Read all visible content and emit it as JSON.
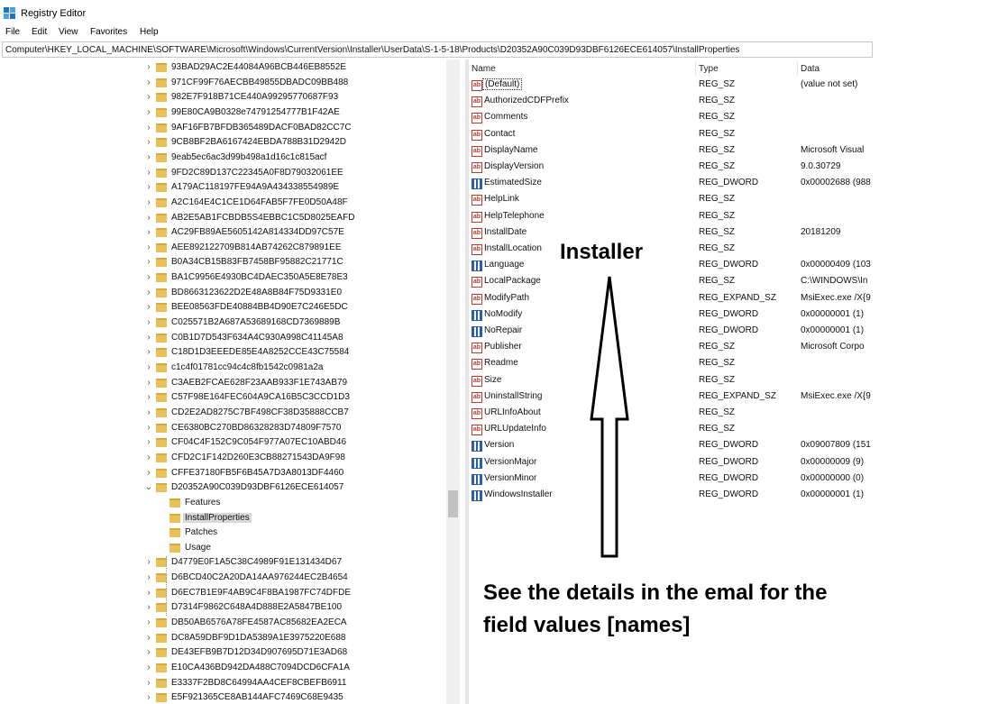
{
  "window": {
    "title": "Registry Editor",
    "menu": [
      "File",
      "Edit",
      "View",
      "Favorites",
      "Help"
    ],
    "address": "Computer\\HKEY_LOCAL_MACHINE\\SOFTWARE\\Microsoft\\Windows\\CurrentVersion\\Installer\\UserData\\S-1-5-18\\Products\\D20352A90C039D93DBF6126ECE614057\\InstallProperties"
  },
  "tree": {
    "keys_before": [
      "93BAD29AC2E44084A96BCB446EB8552E",
      "971CF99F76AECBB49855DBADC09BB488",
      "982E7F918B71CE440A99295770687F93",
      "99E80CA9B0328e74791254777B1F42AE",
      "9AF16FB7BFDB365489DACF0BAD82CC7C",
      "9CB8BF2BA6167424EBDA788B31D2942D",
      "9eab5ec6ac3d99b498a1d16c1c815acf",
      "9FD2C89D137C22345A0F8D79032061EE",
      "A179AC118197FE94A9A434338554989E",
      "A2C164E4C1CE1D64FAB5F7FE0D50A48F",
      "AB2E5AB1FCBDB5S4EBBC1C5D8025EAFD",
      "AC29FB89AE5605142A814334DD97C57E",
      "AEE892122709B814AB74262C879891EE",
      "B0A34CB15B83FB7458BF95882C21771C",
      "BA1C9956E4930BC4DAEC350A5E8E78E3",
      "BD8663123622D2E48A8B84F75D9331E0",
      "BEE08563FDE40884BB4D90E7C246E5DC",
      "C025571B2A687A53689168CD7369889B",
      "C0B1D7D543F634A4C930A998C41145A8",
      "C18D1D3EEEDE85E4A8252CCE43C75584",
      "c1c4f01781cc94c4c8fb1542c0981a2a",
      "C3AEB2FCAE628F23AAB933F1E743AB79",
      "C57F98E164FEC604A9CA16B5C3CCD1D3",
      "CD2E2AD8275C7BF498CF38D35888CCB7",
      "CE6380BC270BD86328283D74809F7570",
      "CF04C4F152C9C054F977A07EC10ABD46",
      "CFD2C1F142D260E3CB88271543DA9F98",
      "CFFE37180FB5F6B45A7D3A8013DF4460"
    ],
    "expanded_key": "D20352A90C039D93DBF6126ECE614057",
    "subkeys": [
      "Features",
      "InstallProperties",
      "Patches",
      "Usage"
    ],
    "selected_subkey_index": 1,
    "keys_after": [
      "D4779E0F1A5C38C4989F91E131434D67",
      "D6BCD40C2A20DA14AA976244EC2B4654",
      "D6EC7B1E9F4AB9C4F8BA1987FC74DFDE",
      "D7314F9862C648A4D888E2A5847BE100",
      "DB50AB6576A78FE4587AC85682EA2ECA",
      "DC8A59DBF9D1DA5389A1E3975220E688",
      "DE43EFB9B7D12D34D907695D71E3AD68",
      "E10CA436BD942DA488C7094DCD6CFA1A",
      "E3337F2BD8C64994AA4CEF8CBEFB6911",
      "E5F921365CE8AB144AFC7469C68E9435"
    ]
  },
  "values": {
    "headers": {
      "name": "Name",
      "type": "Type",
      "data": "Data"
    },
    "rows": [
      {
        "name": "(Default)",
        "type": "REG_SZ",
        "data": "(value not set)",
        "icon": "string-value-icon"
      },
      {
        "name": "AuthorizedCDFPrefix",
        "type": "REG_SZ",
        "data": "",
        "icon": "string-value-icon"
      },
      {
        "name": "Comments",
        "type": "REG_SZ",
        "data": "",
        "icon": "string-value-icon"
      },
      {
        "name": "Contact",
        "type": "REG_SZ",
        "data": "",
        "icon": "string-value-icon"
      },
      {
        "name": "DisplayName",
        "type": "REG_SZ",
        "data": "Microsoft Visual",
        "icon": "string-value-icon"
      },
      {
        "name": "DisplayVersion",
        "type": "REG_SZ",
        "data": "9.0.30729",
        "icon": "string-value-icon"
      },
      {
        "name": "EstimatedSize",
        "type": "REG_DWORD",
        "data": "0x00002688 (988",
        "icon": "binary-value-icon"
      },
      {
        "name": "HelpLink",
        "type": "REG_SZ",
        "data": "",
        "icon": "string-value-icon"
      },
      {
        "name": "HelpTelephone",
        "type": "REG_SZ",
        "data": "",
        "icon": "string-value-icon"
      },
      {
        "name": "InstallDate",
        "type": "REG_SZ",
        "data": "20181209",
        "icon": "string-value-icon"
      },
      {
        "name": "InstallLocation",
        "type": "REG_SZ",
        "data": "",
        "icon": "string-value-icon"
      },
      {
        "name": "Language",
        "type": "REG_DWORD",
        "data": "0x00000409 (103",
        "icon": "binary-value-icon"
      },
      {
        "name": "LocalPackage",
        "type": "REG_SZ",
        "data": "C:\\WINDOWS\\In",
        "icon": "string-value-icon"
      },
      {
        "name": "ModifyPath",
        "type": "REG_EXPAND_SZ",
        "data": "MsiExec.exe /X{9",
        "icon": "string-value-icon"
      },
      {
        "name": "NoModify",
        "type": "REG_DWORD",
        "data": "0x00000001 (1)",
        "icon": "binary-value-icon"
      },
      {
        "name": "NoRepair",
        "type": "REG_DWORD",
        "data": "0x00000001 (1)",
        "icon": "binary-value-icon"
      },
      {
        "name": "Publisher",
        "type": "REG_SZ",
        "data": "Microsoft Corpo",
        "icon": "string-value-icon"
      },
      {
        "name": "Readme",
        "type": "REG_SZ",
        "data": "",
        "icon": "string-value-icon"
      },
      {
        "name": "Size",
        "type": "REG_SZ",
        "data": "",
        "icon": "string-value-icon"
      },
      {
        "name": "UninstallString",
        "type": "REG_EXPAND_SZ",
        "data": "MsiExec.exe /X{9",
        "icon": "string-value-icon"
      },
      {
        "name": "URLInfoAbout",
        "type": "REG_SZ",
        "data": "",
        "icon": "string-value-icon"
      },
      {
        "name": "URLUpdateInfo",
        "type": "REG_SZ",
        "data": "",
        "icon": "string-value-icon"
      },
      {
        "name": "Version",
        "type": "REG_DWORD",
        "data": "0x09007809 (151",
        "icon": "binary-value-icon"
      },
      {
        "name": "VersionMajor",
        "type": "REG_DWORD",
        "data": "0x00000009 (9)",
        "icon": "binary-value-icon"
      },
      {
        "name": "VersionMinor",
        "type": "REG_DWORD",
        "data": "0x00000000 (0)",
        "icon": "binary-value-icon"
      },
      {
        "name": "WindowsInstaller",
        "type": "REG_DWORD",
        "data": "0x00000001 (1)",
        "icon": "binary-value-icon"
      }
    ]
  },
  "annotations": {
    "arrow_label": "Installer",
    "note_line_1": "See the details in the emal for the",
    "note_line_2": "field values [names]"
  },
  "colors": {
    "folder": "#e8c15a",
    "selection": "#d9d9d9",
    "string_icon": "#c0392b",
    "dword_icon": "#2a5db0"
  }
}
